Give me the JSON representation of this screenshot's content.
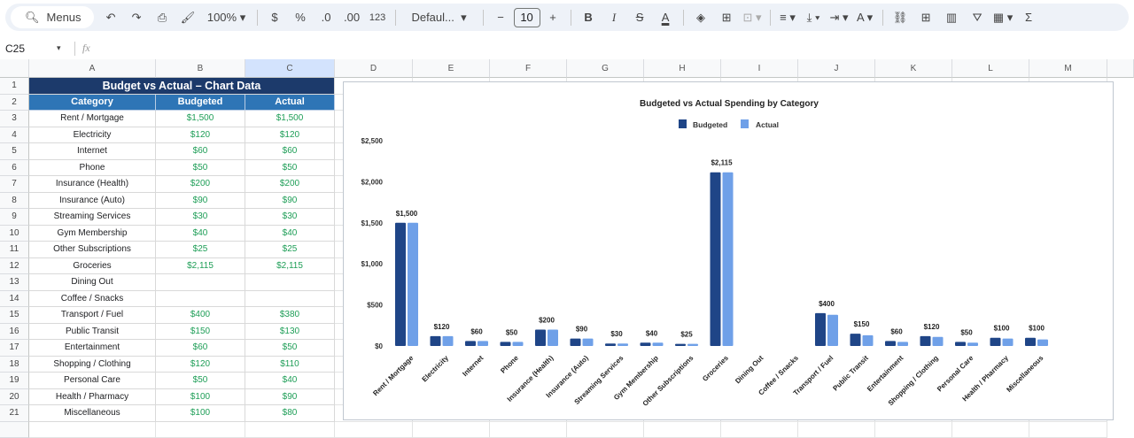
{
  "toolbar": {
    "search_label": "Menus",
    "zoom": "100%",
    "currency": "$",
    "percent": "%",
    "decrease_decimal": ".0",
    "increase_decimal": ".00",
    "number_format": "123",
    "font": "Defaul...",
    "font_size": "10",
    "bold": "B",
    "italic": "I",
    "sum": "Σ"
  },
  "formula_bar": {
    "cell_ref": "C25",
    "fx": "fx",
    "value": ""
  },
  "columns": [
    "A",
    "B",
    "C",
    "D",
    "E",
    "F",
    "G",
    "H",
    "I",
    "J",
    "K",
    "L",
    "M"
  ],
  "selected_column": "C",
  "sheet": {
    "title": "Budget vs Actual – Chart Data",
    "headers": [
      "Category",
      "Budgeted",
      "Actual"
    ],
    "rows": [
      [
        "Rent / Mortgage",
        "$1,500",
        "$1,500"
      ],
      [
        "Electricity",
        "$120",
        "$120"
      ],
      [
        "Internet",
        "$60",
        "$60"
      ],
      [
        "Phone",
        "$50",
        "$50"
      ],
      [
        "Insurance (Health)",
        "$200",
        "$200"
      ],
      [
        "Insurance (Auto)",
        "$90",
        "$90"
      ],
      [
        "Streaming Services",
        "$30",
        "$30"
      ],
      [
        "Gym Membership",
        "$40",
        "$40"
      ],
      [
        "Other Subscriptions",
        "$25",
        "$25"
      ],
      [
        "Groceries",
        "$2,115",
        "$2,115"
      ],
      [
        "Dining Out",
        "",
        ""
      ],
      [
        "Coffee / Snacks",
        "",
        ""
      ],
      [
        "Transport / Fuel",
        "$400",
        "$380"
      ],
      [
        "Public Transit",
        "$150",
        "$130"
      ],
      [
        "Entertainment",
        "$60",
        "$50"
      ],
      [
        "Shopping / Clothing",
        "$120",
        "$110"
      ],
      [
        "Personal Care",
        "$50",
        "$40"
      ],
      [
        "Health / Pharmacy",
        "$100",
        "$90"
      ],
      [
        "Miscellaneous",
        "$100",
        "$80"
      ]
    ]
  },
  "colors": {
    "title_bg": "#1c3a6b",
    "header_bg": "#2e75b6",
    "value_text": "#1e9e57",
    "budgeted": "#1f4587",
    "actual": "#6fa0e8",
    "selected_col": "#d3e3fd"
  },
  "chart_data": {
    "type": "bar",
    "title": "Budgeted vs Actual Spending by Category",
    "legend_position": "top",
    "categories": [
      "Rent / Mortgage",
      "Electricity",
      "Internet",
      "Phone",
      "Insurance (Health)",
      "Insurance (Auto)",
      "Streaming Services",
      "Gym Membership",
      "Other Subscriptions",
      "Groceries",
      "Dining Out",
      "Coffee / Snacks",
      "Transport / Fuel",
      "Public Transit",
      "Entertainment",
      "Shopping / Clothing",
      "Personal Care",
      "Health / Pharmacy",
      "Miscellaneous"
    ],
    "series": [
      {
        "name": "Budgeted",
        "values": [
          1500,
          120,
          60,
          50,
          200,
          90,
          30,
          40,
          25,
          2115,
          0,
          0,
          400,
          150,
          60,
          120,
          50,
          100,
          100
        ]
      },
      {
        "name": "Actual",
        "values": [
          1500,
          120,
          60,
          50,
          200,
          90,
          30,
          40,
          25,
          2115,
          0,
          0,
          380,
          130,
          50,
          110,
          40,
          90,
          80
        ]
      }
    ],
    "data_labels": [
      "$1,500",
      "$120",
      "$60",
      "$50",
      "$200",
      "$90",
      "$30",
      "$40",
      "$25",
      "$2,115",
      "",
      "",
      "$400",
      "$150",
      "$60",
      "$120",
      "$50",
      "$100",
      "$100"
    ],
    "yticks": [
      "$0",
      "$500",
      "$1,000",
      "$1,500",
      "$2,000",
      "$2,500"
    ],
    "ylim": [
      0,
      2500
    ],
    "grid": false
  }
}
